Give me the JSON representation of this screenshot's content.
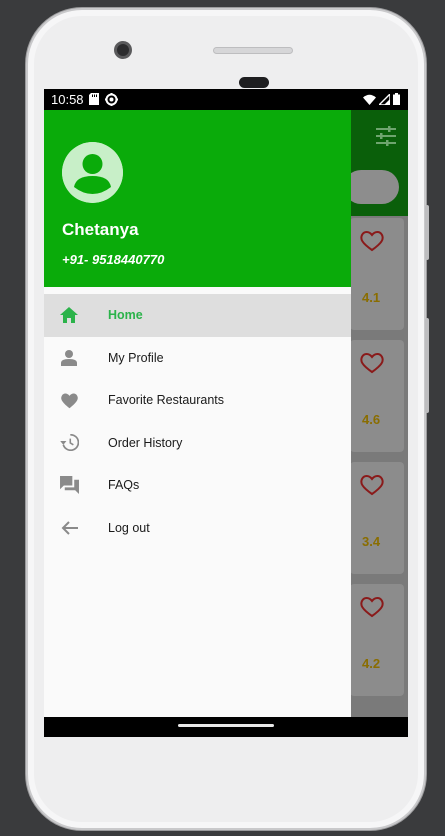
{
  "status_bar": {
    "time": "10:58",
    "left_icons": [
      "sd-card-icon",
      "settings-sync-icon"
    ],
    "right_icons": [
      "wifi-icon",
      "signal-icon",
      "battery-icon"
    ]
  },
  "drawer": {
    "header": {
      "user_name": "Chetanya",
      "user_phone": "+91- 9518440770",
      "color": "#0aab0a"
    },
    "items": [
      {
        "label": "Home",
        "icon": "home-icon",
        "selected": true
      },
      {
        "label": "My Profile",
        "icon": "person-icon",
        "selected": false
      },
      {
        "label": "Favorite Restaurants",
        "icon": "heart-icon",
        "selected": false
      },
      {
        "label": "Order History",
        "icon": "history-icon",
        "selected": false
      },
      {
        "label": "FAQs",
        "icon": "forum-icon",
        "selected": false
      },
      {
        "label": "Log out",
        "icon": "arrow-back-icon",
        "selected": false
      }
    ],
    "accent": "#2bb34a"
  },
  "background_app": {
    "toolbar_color": "#0a5f0a",
    "cards": [
      {
        "rating": "4.1"
      },
      {
        "rating": "4.6"
      },
      {
        "rating": "3.4"
      },
      {
        "rating": "4.2"
      }
    ]
  }
}
